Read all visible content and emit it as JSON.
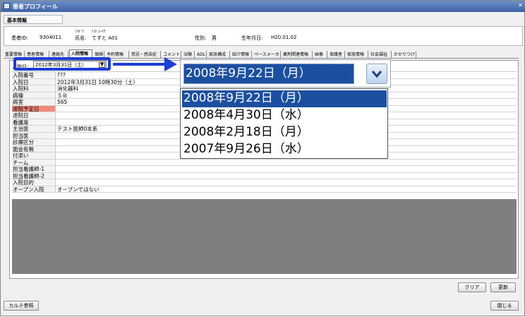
{
  "window": {
    "title": "患者プロフィール",
    "close": "✕"
  },
  "section_label": "基本情報",
  "patient": {
    "id_label": "患者ID:",
    "id": "9304011",
    "furigana_label": "ﾌﾘｶﾞﾅ",
    "furigana": "ﾃｽﾄ ｴｰｲﾁ",
    "name_label": "氏名:",
    "name": "てすと A01",
    "sex_label": "性別:",
    "sex": "男",
    "dob_label": "生年月日:",
    "dob": "H20.01.02"
  },
  "tabs": [
    "重要情報",
    "患者情報",
    "連絡先",
    "入院情報",
    "保険",
    "予約情報",
    "禁忌・感染症",
    "コメント",
    "治験",
    "ADL",
    "家族構成",
    "紹介情報",
    "ペースメーカ",
    "薬剤関連情報",
    "画像",
    "保護者",
    "家族情報",
    "社会福祉",
    "かかりつけ"
  ],
  "active_tab_index": 3,
  "admission": {
    "label": "入院日：",
    "selected": "2012年3月31日（土）"
  },
  "rows": [
    {
      "label": "入院番号",
      "value": "???"
    },
    {
      "label": "入院日",
      "value": "2012年3月31日 10時30分（土）"
    },
    {
      "label": "入院科",
      "value": "消化器科"
    },
    {
      "label": "病棟",
      "value": "５Ｂ"
    },
    {
      "label": "病室",
      "value": "565"
    },
    {
      "label": "退院予定日",
      "value": "",
      "highlight": true
    },
    {
      "label": "退院日",
      "value": ""
    },
    {
      "label": "看護度",
      "value": ""
    },
    {
      "label": "主治医",
      "value": "テスト医師0本系"
    },
    {
      "label": "担当医",
      "value": ""
    },
    {
      "label": "診療区分",
      "value": ""
    },
    {
      "label": "面会有無",
      "value": ""
    },
    {
      "label": "付添い",
      "value": ""
    },
    {
      "label": "チーム",
      "value": ""
    },
    {
      "label": "担当看護師-1",
      "value": ""
    },
    {
      "label": "担当看護師-2",
      "value": ""
    },
    {
      "label": "入院目的",
      "value": ""
    },
    {
      "label": "オープン入院",
      "value": "オープンではない"
    }
  ],
  "buttons": {
    "clear": "クリア",
    "update": "更新",
    "karte": "カルテ参照",
    "close": "閉じる"
  },
  "callout": {
    "selected": "2008年9月22日（月）",
    "options": [
      "2008年9月22日（月）",
      "2008年4月30日（水）",
      "2008年2月18日（月）",
      "2007年9月26日（水）"
    ],
    "selected_index": 0
  },
  "colors": {
    "accent": "#1d3fd6",
    "selection": "#1c4fa0",
    "warning_row": "#f08a7a"
  }
}
